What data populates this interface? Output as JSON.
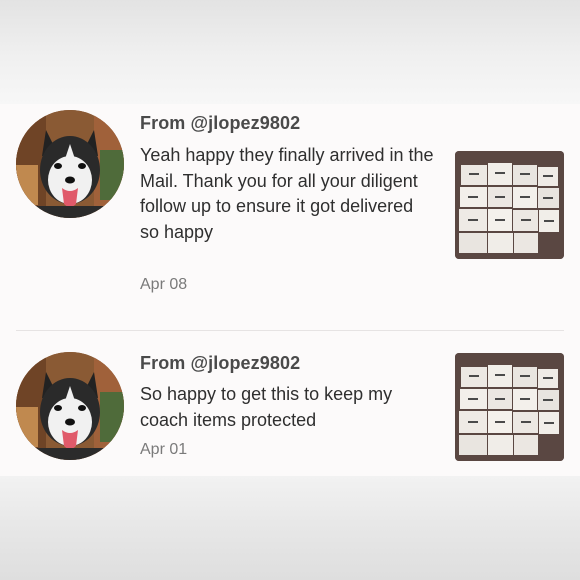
{
  "reviews": [
    {
      "from": "From @jlopez9802",
      "text": "Yeah happy they finally arrived in the Mail. Thank you for all your diligent follow up to ensure it got delivered so happy",
      "date": "Apr 08",
      "avatar": "husky-dog-avatar",
      "photo": "dust-bags-photo"
    },
    {
      "from": "From @jlopez9802",
      "text": "So happy to get this to keep my coach items protected",
      "date": "Apr 01",
      "avatar": "husky-dog-avatar",
      "photo": "dust-bags-photo"
    }
  ]
}
